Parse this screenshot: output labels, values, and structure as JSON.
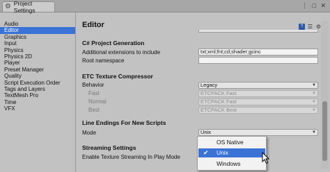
{
  "window": {
    "tab_title": "Project Settings",
    "window_buttons": "⋮ □ ✕"
  },
  "sidebar": {
    "items": [
      {
        "label": "Audio"
      },
      {
        "label": "Editor"
      },
      {
        "label": "Graphics"
      },
      {
        "label": "Input"
      },
      {
        "label": "Physics"
      },
      {
        "label": "Physics 2D"
      },
      {
        "label": "Player"
      },
      {
        "label": "Preset Manager"
      },
      {
        "label": "Quality"
      },
      {
        "label": "Script Execution Order"
      },
      {
        "label": "Tags and Layers"
      },
      {
        "label": "TextMesh Pro"
      },
      {
        "label": "Time"
      },
      {
        "label": "VFX"
      }
    ],
    "selected": "Editor"
  },
  "main": {
    "title": "Editor",
    "sections": {
      "csharp": {
        "heading": "C# Project Generation",
        "ext_label": "Additional extensions to include",
        "ext_value": "txt;xml;fnt;cd;shader;gcinc",
        "ns_label": "Root namespace",
        "ns_value": ""
      },
      "etc": {
        "heading": "ETC Texture Compressor",
        "behavior_label": "Behavior",
        "behavior_value": "Legacy",
        "fast_label": "Fast",
        "fast_value": "ETCPACK Fast",
        "normal_label": "Normal",
        "normal_value": "ETCPACK Fast",
        "best_label": "Best",
        "best_value": "ETCPACK Best"
      },
      "line_endings": {
        "heading": "Line Endings For New Scripts",
        "mode_label": "Mode",
        "mode_value": "Unix"
      },
      "streaming": {
        "heading": "Streaming Settings",
        "enable_label": "Enable Texture Streaming In Play Mode"
      }
    }
  },
  "dropdown": {
    "options": [
      {
        "label": "OS Native",
        "selected": false
      },
      {
        "label": "Unix",
        "selected": true
      },
      {
        "label": "Windows",
        "selected": false
      }
    ]
  },
  "icons": {
    "gear": "⚙",
    "caret": "▼",
    "check": "✔",
    "help": "?",
    "settings": "☰"
  }
}
